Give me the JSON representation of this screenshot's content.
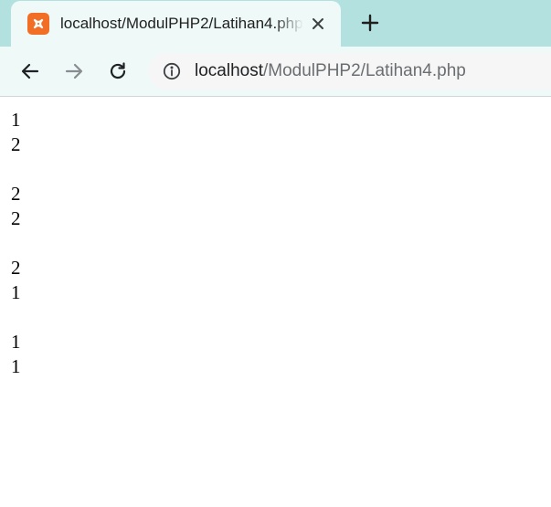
{
  "browser": {
    "tab": {
      "title": "localhost/ModulPHP2/Latihan4.php",
      "favicon": "xampp-icon",
      "close_icon": "close-icon"
    },
    "new_tab_icon": "plus-icon",
    "nav": {
      "back_icon": "arrow-left-icon",
      "forward_icon": "arrow-right-icon",
      "reload_icon": "reload-icon"
    },
    "address_bar": {
      "info_icon": "info-icon",
      "host": "localhost",
      "path": "/ModulPHP2/Latihan4.php"
    },
    "colors": {
      "tabstrip": "#b2e1df",
      "toolbar": "#eef9f8",
      "favicon": "#f36e25"
    }
  },
  "page": {
    "groups": [
      [
        "1",
        "2"
      ],
      [
        "2",
        "2"
      ],
      [
        "2",
        "1"
      ],
      [
        "1",
        "1"
      ]
    ]
  }
}
